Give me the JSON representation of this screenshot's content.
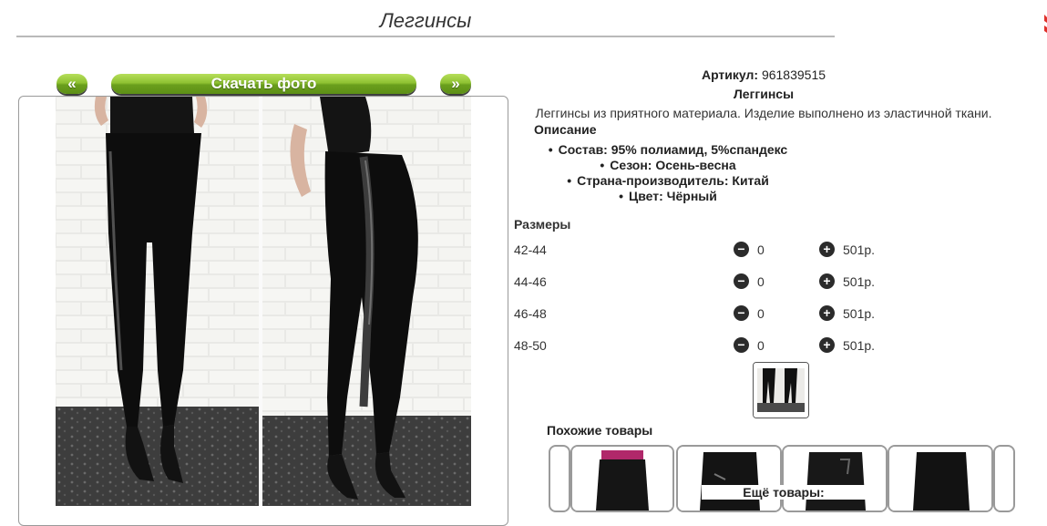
{
  "page": {
    "title": "Леггинсы"
  },
  "gallery": {
    "prev_label": "«",
    "next_label": "»",
    "download_label": "Скачать фото"
  },
  "product": {
    "article_label": "Артикул:",
    "article": "961839515",
    "name": "Леггинсы",
    "description": "Леггинсы из приятного материала. Изделие выполнено из эластичной ткани.",
    "description_heading": "Описание",
    "properties": [
      "Состав: 95% полиамид, 5%спандекс",
      "Сезон: Осень-весна",
      "Страна-производитель: Китай",
      "Цвет: Чёрный"
    ]
  },
  "sizes": {
    "heading": "Размеры",
    "rows": [
      {
        "size": "42-44",
        "qty": "0",
        "price": "501р."
      },
      {
        "size": "44-46",
        "qty": "0",
        "price": "501р."
      },
      {
        "size": "46-48",
        "qty": "0",
        "price": "501р."
      },
      {
        "size": "48-50",
        "qty": "0",
        "price": "501р."
      }
    ]
  },
  "similar": {
    "heading": "Похожие товары",
    "more_label": "Ещё товары:"
  },
  "colors": {
    "accent_green": "#8fc232",
    "button_dark": "#2b2b2b",
    "brand_red": "#e0312b"
  }
}
